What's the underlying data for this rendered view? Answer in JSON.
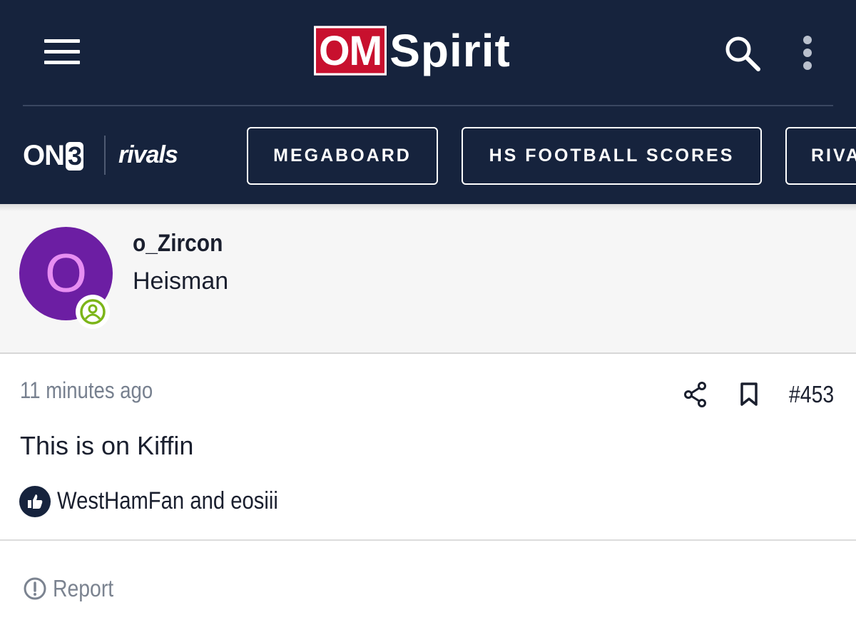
{
  "header": {
    "logo_om": "OM",
    "logo_spirit": "Spirit",
    "menu_icon": "hamburger-menu-icon",
    "search_icon": "search-icon",
    "more_icon": "vertical-dots-icon",
    "background_color": "#16233d"
  },
  "nav": {
    "brand_on3_prefix": "ON",
    "brand_on3_digit": "3",
    "brand_rivals": "rivals",
    "buttons": [
      {
        "label": "MEGABOARD"
      },
      {
        "label": "HS FOOTBALL SCORES"
      },
      {
        "label": "RIVA"
      }
    ]
  },
  "post": {
    "author": {
      "avatar_letter": "O",
      "avatar_color": "#6c1ea3",
      "username": "o_Zircon",
      "title": "Heisman",
      "online_icon": "online-user-icon",
      "online_color": "#7cb518"
    },
    "timestamp": "11 minutes ago",
    "share_icon": "share-icon",
    "bookmark_icon": "bookmark-icon",
    "post_number": "#453",
    "body": "This is on Kiffin",
    "reactions": {
      "icon": "thumbs-up-icon",
      "text": "WestHamFan and eosiii"
    },
    "report": {
      "icon": "alert-circle-icon",
      "label": "Report"
    }
  }
}
